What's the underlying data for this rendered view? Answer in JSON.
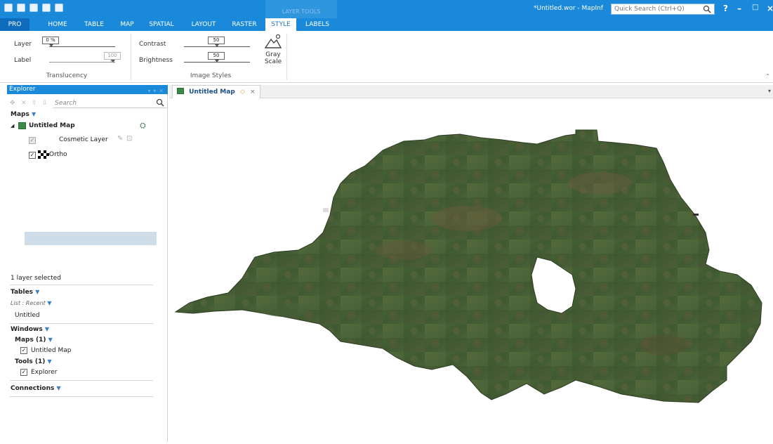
{
  "titlebar": {
    "window_title": "*Untitled.wor - MapInf",
    "quick_search_placeholder": "Quick Search (Ctrl+Q)",
    "context_label": "LAYER TOOLS",
    "help": "?",
    "minimize": "–",
    "maximize": "□",
    "close": "×"
  },
  "tabs": [
    "PRO",
    "HOME",
    "TABLE",
    "MAP",
    "SPATIAL",
    "LAYOUT",
    "RASTER",
    "STYLE",
    "LABELS"
  ],
  "ribbon": {
    "translucency": {
      "layer_label": "Layer",
      "layer_value": "0 %",
      "label_label": "Label",
      "label_value": "100 %",
      "group_title": "Translucency"
    },
    "image_styles": {
      "contrast_label": "Contrast",
      "contrast_value": "50",
      "brightness_label": "Brightness",
      "brightness_value": "50",
      "gray_scale_line1": "Gray",
      "gray_scale_line2": "Scale",
      "group_title": "Image Styles"
    }
  },
  "explorer": {
    "title": "Explorer",
    "search_placeholder": "Search",
    "maps_heading": "Maps",
    "map_name": "Untitled Map",
    "layers": [
      "Cosmetic Layer",
      "Ortho"
    ],
    "selection_status": "1 layer selected",
    "tables_heading": "Tables",
    "tables_list_label": "List : Recent",
    "tables": [
      "Untitled"
    ],
    "windows_heading": "Windows",
    "maps_group": "Maps (1)",
    "maps_items": [
      "Untitled Map"
    ],
    "tools_group": "Tools (1)",
    "tools_items": [
      "Explorer"
    ],
    "connections_heading": "Connections"
  },
  "document": {
    "tab_label": "Untitled Map",
    "tab_close": "×"
  },
  "colors": {
    "accent": "#1a89d9",
    "ribbon_active_text": "#1a73c1",
    "selection_row": "#cfdde9"
  }
}
